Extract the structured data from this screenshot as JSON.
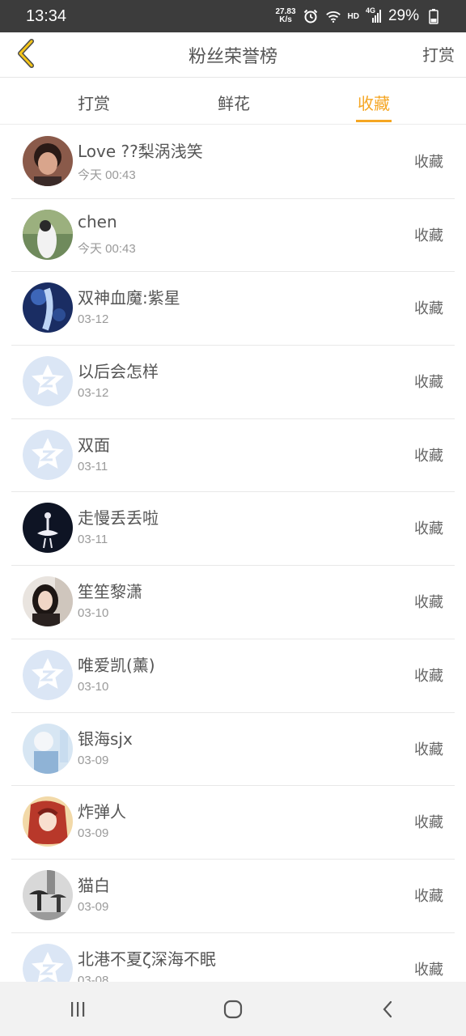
{
  "status_bar": {
    "time": "13:34",
    "net_speed_value": "27.83",
    "net_speed_unit": "K/s",
    "hd_label": "HD",
    "network_label": "4G",
    "battery_percent": "29%"
  },
  "header": {
    "title": "粉丝荣誉榜",
    "right_action": "打赏"
  },
  "tabs": [
    {
      "label": "打赏",
      "active": false
    },
    {
      "label": "鲜花",
      "active": false
    },
    {
      "label": "收藏",
      "active": true
    }
  ],
  "list": {
    "items": [
      {
        "name": "Love ??梨涡浅笑",
        "date": "今天 00:43",
        "action": "收藏",
        "avatar": "photo-portrait"
      },
      {
        "name": "chen",
        "date": "今天 00:43",
        "action": "收藏",
        "avatar": "photo-girl"
      },
      {
        "name": "双神血魔:紫星",
        "date": "03-12",
        "action": "收藏",
        "avatar": "anime-blue"
      },
      {
        "name": "以后会怎样",
        "date": "03-12",
        "action": "收藏",
        "avatar": "default-star"
      },
      {
        "name": "双面",
        "date": "03-11",
        "action": "收藏",
        "avatar": "default-star"
      },
      {
        "name": "走慢丢丢啦",
        "date": "03-11",
        "action": "收藏",
        "avatar": "dark-ballerina"
      },
      {
        "name": "笙笙黎潇",
        "date": "03-10",
        "action": "收藏",
        "avatar": "photo-girl2"
      },
      {
        "name": "唯爱凯(薰)",
        "date": "03-10",
        "action": "收藏",
        "avatar": "default-star"
      },
      {
        "name": "银海sjx",
        "date": "03-09",
        "action": "收藏",
        "avatar": "anime-light"
      },
      {
        "name": "炸弹人",
        "date": "03-09",
        "action": "收藏",
        "avatar": "anime-red"
      },
      {
        "name": "猫白",
        "date": "03-09",
        "action": "收藏",
        "avatar": "bw-rain"
      },
      {
        "name": "北港不夏ζ深海不眠",
        "date": "03-08",
        "action": "收藏",
        "avatar": "default-star"
      }
    ]
  },
  "colors": {
    "accent": "#f5a623",
    "status_bar_bg": "#3c3c3c",
    "default_avatar": "#dbe6f5"
  },
  "icons": {
    "back": "chevron-left-icon",
    "wifi": "wifi-icon",
    "alarm": "alarm-icon",
    "signal": "signal-icon",
    "battery": "battery-icon",
    "default_avatar": "star-z-icon",
    "bottom_nav": [
      "recent-apps-icon",
      "home-icon",
      "back-icon"
    ]
  }
}
